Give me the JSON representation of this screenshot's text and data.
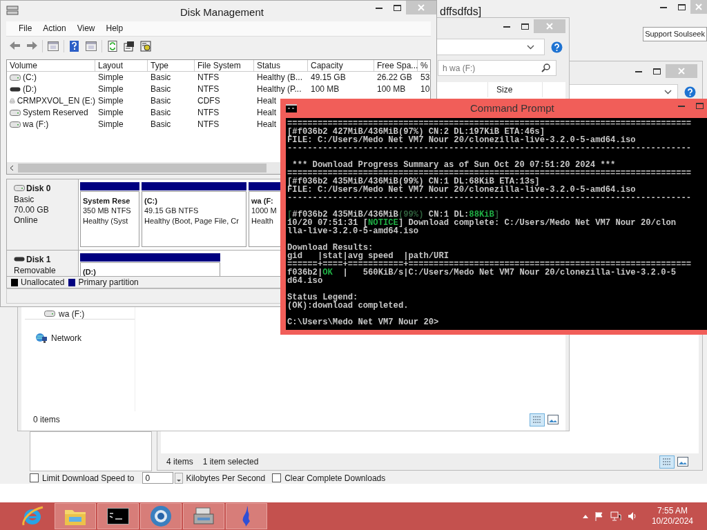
{
  "soulseek": {
    "title": "dffsdfds]",
    "support_button": "Support Soulseek",
    "limit_speed": {
      "label": "Limit Download Speed to",
      "checked": false
    },
    "speed_value": "0",
    "speed_unit": "Kilobytes Per Second",
    "clear_downloads": {
      "label": "Clear Complete Downloads",
      "checked": false
    }
  },
  "explorer_back": {
    "item_count": "4 items",
    "selection": "1 item selected"
  },
  "explorer_front": {
    "search_placeholder": "h wa (F:)",
    "column": "Size",
    "nav_items": [
      {
        "label": "wa (F:)",
        "kind": "drive"
      },
      {
        "label": "Network",
        "kind": "network"
      }
    ],
    "item_count": "0 items"
  },
  "disk_management": {
    "title": "Disk Management",
    "menu": [
      "File",
      "Action",
      "View",
      "Help"
    ],
    "columns": [
      "Volume",
      "Layout",
      "Type",
      "File System",
      "Status",
      "Capacity",
      "Free Spa...",
      "%"
    ],
    "volumes": [
      {
        "kind": "drive",
        "cells": [
          "(C:)",
          "Simple",
          "Basic",
          "NTFS",
          "Healthy (B...",
          "49.15 GB",
          "26.22 GB",
          "53"
        ]
      },
      {
        "kind": "removable",
        "cells": [
          "(D:)",
          "Simple",
          "Basic",
          "NTFS",
          "Healthy (P...",
          "100 MB",
          "100 MB",
          "10"
        ]
      },
      {
        "kind": "cd",
        "cells": [
          "CRMPXVOL_EN (E:)",
          "Simple",
          "Basic",
          "CDFS",
          "Healt"
        ]
      },
      {
        "kind": "drive",
        "cells": [
          "System Reserved",
          "Simple",
          "Basic",
          "NTFS",
          "Healt"
        ]
      },
      {
        "kind": "drive",
        "cells": [
          "wa (F:)",
          "Simple",
          "Basic",
          "NTFS",
          "Healt"
        ]
      }
    ],
    "disks": [
      {
        "kind": "fixed",
        "name": "Disk 0",
        "details": [
          "Basic",
          "70.00 GB",
          "Online"
        ],
        "partitions": [
          {
            "name": "System Rese",
            "lines": [
              "350 MB NTFS",
              "Healthy (Syst"
            ]
          },
          {
            "name": "(C:)",
            "lines": [
              "49.15 GB NTFS",
              "Healthy (Boot, Page File, Cr"
            ]
          },
          {
            "name": "wa (F:",
            "lines": [
              "1000 M",
              "Health"
            ]
          }
        ]
      },
      {
        "kind": "removable",
        "name": "Disk 1",
        "details": [
          "Removable"
        ],
        "partitions": [
          {
            "name": "(D:)"
          }
        ]
      }
    ],
    "legend": [
      {
        "label": "Unallocated",
        "color": "#000000"
      },
      {
        "label": "Primary partition",
        "color": "#000080"
      }
    ]
  },
  "command_prompt": {
    "title": "Command Prompt",
    "lines": [
      {
        "segments": [
          {
            "text": "================================================================================"
          }
        ]
      },
      {
        "segments": [
          {
            "text": "[#f036b2 427MiB/436MiB(97%) CN:2 DL:197KiB ETA:46s]"
          }
        ]
      },
      {
        "segments": [
          {
            "text": "FILE: C:/Users/Medo Net VM7 Nour 20/clonezilla-live-3.2.0-5-amd64.iso"
          }
        ]
      },
      {
        "segments": [
          {
            "text": "--------------------------------------------------------------------------------"
          }
        ]
      },
      {
        "kind": "blank"
      },
      {
        "segments": [
          {
            "text": " *** Download Progress Summary as of Sun Oct 20 07:51:20 2024 ***"
          }
        ]
      },
      {
        "segments": [
          {
            "text": "================================================================================"
          }
        ]
      },
      {
        "segments": [
          {
            "text": "[#f036b2 435MiB/436MiB(99%) CN:1 DL:68KiB ETA:13s]"
          }
        ]
      },
      {
        "segments": [
          {
            "text": "FILE: C:/Users/Medo Net VM7 Nour 20/clonezilla-live-3.2.0-5-amd64.iso"
          }
        ]
      },
      {
        "segments": [
          {
            "text": "--------------------------------------------------------------------------------"
          }
        ]
      },
      {
        "kind": "blank"
      },
      {
        "segments": [
          {
            "text": "[",
            "kind": "dim"
          },
          {
            "text": "#f036b2 435MiB/436MiB"
          },
          {
            "text": "(99%)",
            "kind": "dim"
          },
          {
            "text": " CN:1 DL:"
          },
          {
            "text": "88KiB",
            "kind": "ok"
          },
          {
            "text": "]",
            "kind": "dim"
          }
        ]
      },
      {
        "segments": [
          {
            "text": "10/20 07:51:31 ["
          },
          {
            "text": "NOTICE",
            "kind": "ok"
          },
          {
            "text": "] Download complete: C:/Users/Medo Net VM7 Nour 20/clon"
          }
        ]
      },
      {
        "segments": [
          {
            "text": "lla-live-3.2.0-5-amd64.iso"
          }
        ]
      },
      {
        "kind": "blank"
      },
      {
        "segments": [
          {
            "text": "Download Results:"
          }
        ]
      },
      {
        "segments": [
          {
            "text": "gid   |stat|avg speed  |path/URI"
          }
        ]
      },
      {
        "segments": [
          {
            "text": "======+====+===========+========================================================"
          }
        ]
      },
      {
        "segments": [
          {
            "text": "f036b2|"
          },
          {
            "text": "OK",
            "kind": "ok"
          },
          {
            "text": "  |   560KiB/s|C:/Users/Medo Net VM7 Nour 20/clonezilla-live-3.2.0-5"
          }
        ]
      },
      {
        "segments": [
          {
            "text": "d64.iso"
          }
        ]
      },
      {
        "kind": "blank"
      },
      {
        "segments": [
          {
            "text": "Status Legend:"
          }
        ]
      },
      {
        "segments": [
          {
            "text": "(OK):download completed."
          }
        ]
      },
      {
        "kind": "blank"
      },
      {
        "segments": [
          {
            "text": "C:\\Users\\Medo Net VM7 Nour 20>"
          }
        ]
      }
    ]
  },
  "taskbar": {
    "apps": [
      {
        "kind": "browser",
        "running": false
      },
      {
        "kind": "folder",
        "running": true
      },
      {
        "kind": "console",
        "running": true
      },
      {
        "kind": "globe",
        "running": true
      },
      {
        "kind": "device",
        "running": true
      },
      {
        "kind": "bird",
        "running": true
      }
    ],
    "time": "7:55 AM",
    "date": "10/20/2024"
  }
}
